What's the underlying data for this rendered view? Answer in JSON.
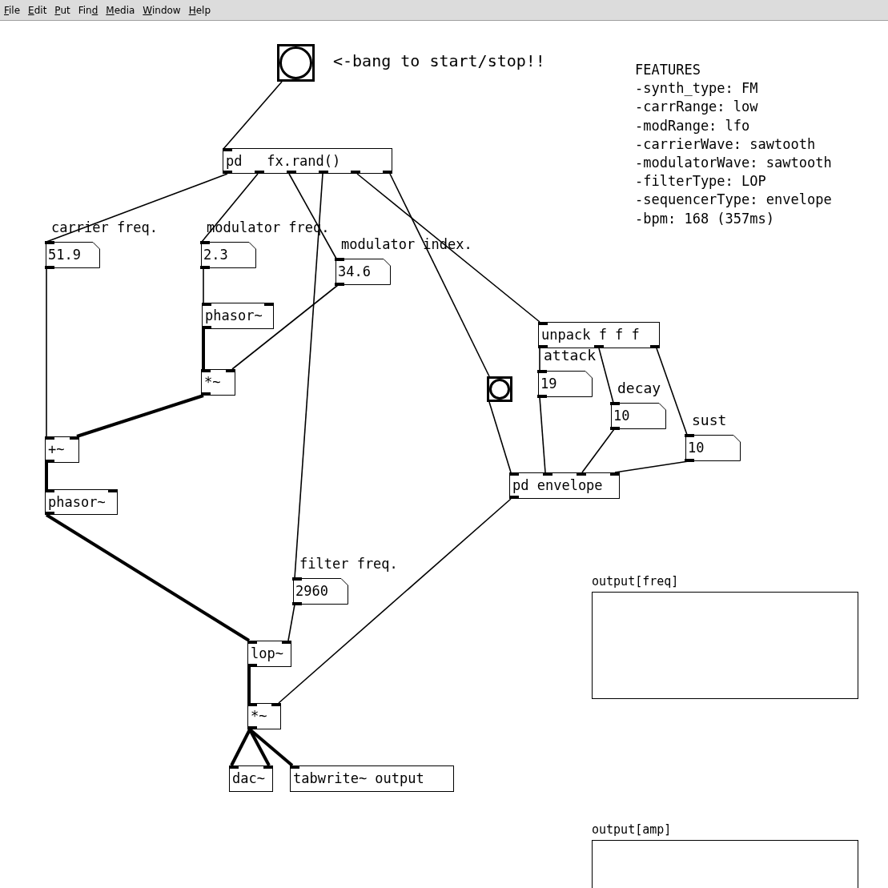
{
  "menu": [
    {
      "key": "F",
      "post": "ile"
    },
    {
      "key": "E",
      "post": "dit"
    },
    {
      "key": "P",
      "post": "ut"
    },
    {
      "pre": "Fin",
      "key": "d"
    },
    {
      "key": "M",
      "post": "edia"
    },
    {
      "key": "W",
      "post": "indow"
    },
    {
      "key": "H",
      "post": "elp"
    }
  ],
  "nodes": [
    {
      "kind": "bang"
    },
    {
      "kind": "comment",
      "text": "<-bang to start/stop!!"
    },
    {
      "kind": "object",
      "text": "pd   fx.rand()"
    },
    {
      "kind": "comment",
      "text": "carrier freq."
    },
    {
      "kind": "number",
      "text": "51.9"
    },
    {
      "kind": "comment",
      "text": "modulator freq."
    },
    {
      "kind": "number",
      "text": "2.3"
    },
    {
      "kind": "comment",
      "text": "modulator index."
    },
    {
      "kind": "number",
      "text": "34.6"
    },
    {
      "kind": "object",
      "text": "phasor~"
    },
    {
      "kind": "object",
      "text": "*~"
    },
    {
      "kind": "object",
      "text": "+~"
    },
    {
      "kind": "object",
      "text": "phasor~"
    },
    {
      "kind": "comment",
      "text": "filter freq."
    },
    {
      "kind": "number",
      "text": "2960"
    },
    {
      "kind": "object",
      "text": "lop~"
    },
    {
      "kind": "object",
      "text": "*~"
    },
    {
      "kind": "object",
      "text": "dac~"
    },
    {
      "kind": "object",
      "text": "tabwrite~ output"
    },
    {
      "kind": "bang"
    },
    {
      "kind": "object",
      "text": "unpack f f f"
    },
    {
      "kind": "comment",
      "text": "attack"
    },
    {
      "kind": "number",
      "text": "19"
    },
    {
      "kind": "comment",
      "text": "decay"
    },
    {
      "kind": "number",
      "text": "10"
    },
    {
      "kind": "comment",
      "text": "sust"
    },
    {
      "kind": "number",
      "text": "10"
    },
    {
      "kind": "object",
      "text": "pd envelope"
    }
  ],
  "features": [
    "FEATURES",
    "-synth_type: FM",
    "-carrRange: low",
    "-modRange: lfo",
    "-carrierWave: sawtooth",
    "-modulatorWave: sawtooth",
    "-filterType: LOP",
    "-sequencerType: envelope",
    "-bpm: 168 (357ms)"
  ],
  "arrays": [
    {
      "name": "output[freq]"
    },
    {
      "name": "output[amp]"
    }
  ]
}
